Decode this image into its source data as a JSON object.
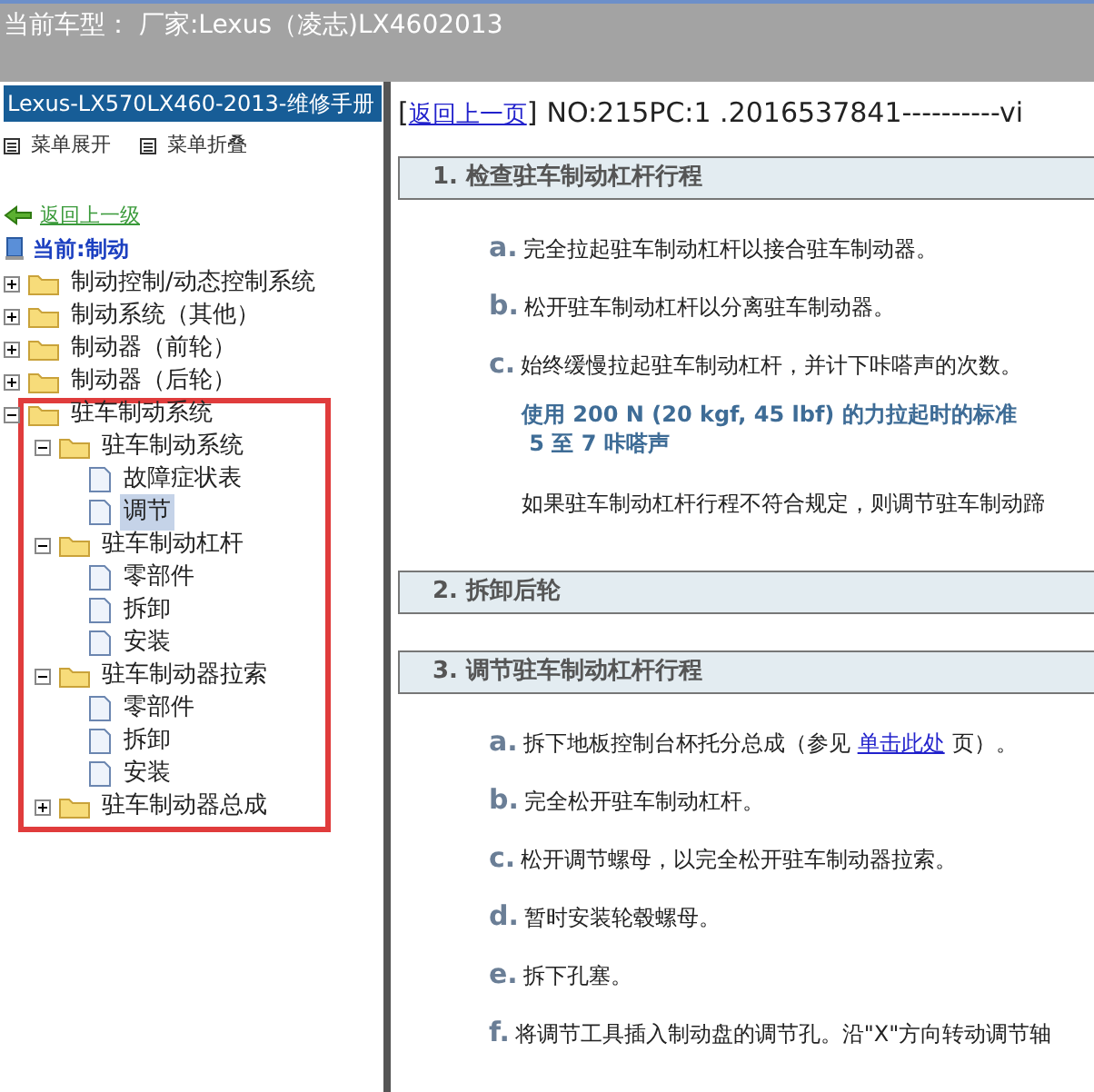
{
  "window": {
    "title": "当前车型： 厂家:Lexus（凌志)LX4602013"
  },
  "sidebar": {
    "title": "Lexus-LX570LX460-2013-维修手册",
    "menu": [
      "菜单展开",
      "菜单折叠"
    ],
    "back_link": "返回上一级",
    "current": "当前:制动",
    "tree": [
      {
        "label": "制动控制/动态控制系统",
        "kind": "folder",
        "expanded": false,
        "selected": false,
        "highlighted": false
      },
      {
        "label": "制动系统（其他）",
        "kind": "folder",
        "expanded": false,
        "selected": false,
        "highlighted": false
      },
      {
        "label": "制动器（前轮）",
        "kind": "folder",
        "expanded": false,
        "selected": false,
        "highlighted": false
      },
      {
        "label": "制动器（后轮）",
        "kind": "folder",
        "expanded": false,
        "selected": false,
        "highlighted": false
      },
      {
        "label": "驻车制动系统",
        "kind": "folder",
        "expanded": true,
        "selected": false,
        "highlighted": true,
        "children": [
          {
            "label": "驻车制动系统",
            "kind": "folder",
            "expanded": true,
            "selected": false,
            "highlighted": false,
            "children": [
              {
                "label": "故障症状表",
                "kind": "page",
                "selected": false
              },
              {
                "label": "调节",
                "kind": "page",
                "selected": true
              }
            ]
          },
          {
            "label": "驻车制动杠杆",
            "kind": "folder",
            "expanded": true,
            "selected": false,
            "highlighted": false,
            "children": [
              {
                "label": "零部件",
                "kind": "page",
                "selected": false
              },
              {
                "label": "拆卸",
                "kind": "page",
                "selected": false
              },
              {
                "label": "安装",
                "kind": "page",
                "selected": false
              }
            ]
          },
          {
            "label": "驻车制动器拉索",
            "kind": "folder",
            "expanded": true,
            "selected": false,
            "highlighted": false,
            "children": [
              {
                "label": "零部件",
                "kind": "page",
                "selected": false
              },
              {
                "label": "拆卸",
                "kind": "page",
                "selected": false
              },
              {
                "label": "安装",
                "kind": "page",
                "selected": false
              }
            ]
          },
          {
            "label": "驻车制动器总成",
            "kind": "folder",
            "expanded": false,
            "selected": false,
            "highlighted": false
          }
        ]
      }
    ]
  },
  "content": {
    "open_bracket": "[",
    "back_link": "返回上一页",
    "close_bracket": "]",
    "doc_id": "NO:215PC:1 .2016537841----------vi",
    "sections": [
      {
        "title": "1. 检查驻车制动杠杆行程",
        "steps": [
          {
            "kind": "step",
            "letter": "a.",
            "text": "完全拉起驻车制动杠杆以接合驻车制动器。"
          },
          {
            "kind": "step",
            "letter": "b.",
            "text": "松开驻车制动杠杆以分离驻车制动器。"
          },
          {
            "kind": "step",
            "letter": "c.",
            "text": "始终缓慢拉起驻车制动杠杆，并计下咔嗒声的次数。"
          },
          {
            "kind": "spec",
            "lines": [
              "使用 200 N (20 kgf, 45 lbf) 的力拉起时的标准",
              " 5 至 7 咔嗒声"
            ]
          },
          {
            "kind": "note",
            "text": "如果驻车制动杠杆行程不符合规定，则调节驻车制动蹄"
          }
        ]
      },
      {
        "title": "2. 拆卸后轮"
      },
      {
        "title": "3. 调节驻车制动杠杆行程",
        "steps": [
          {
            "kind": "step",
            "letter": "a.",
            "text": "拆下地板控制台杯托分总成（参见",
            "link": "单击此处",
            "after": "页）。"
          },
          {
            "kind": "step",
            "letter": "b.",
            "text": "完全松开驻车制动杠杆。"
          },
          {
            "kind": "step",
            "letter": "c.",
            "text": "松开调节螺母，以完全松开驻车制动器拉索。"
          },
          {
            "kind": "step",
            "letter": "d.",
            "text": "暂时安装轮毂螺母。"
          },
          {
            "kind": "step",
            "letter": "e.",
            "text": "拆下孔塞。"
          },
          {
            "kind": "step",
            "letter": "f.",
            "text": "将调节工具插入制动盘的调节孔。沿\"X\"方向转动调节轴"
          }
        ]
      }
    ]
  }
}
